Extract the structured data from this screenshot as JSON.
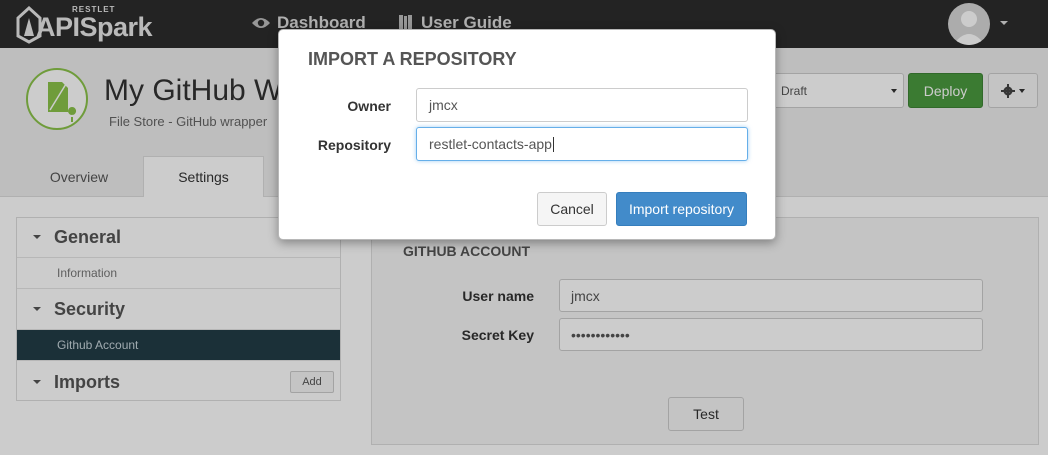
{
  "navbar": {
    "logo_small": "RESTLET",
    "logo_text": "APISpark",
    "links": [
      {
        "label": "Dashboard",
        "icon": "eye-icon"
      },
      {
        "label": "User Guide",
        "icon": "book-icon"
      }
    ]
  },
  "api": {
    "title": "My GitHub W",
    "subtitle": "File Store - GitHub wrapper",
    "status": "Draft",
    "deploy_label": "Deploy"
  },
  "tabs": [
    {
      "label": "Overview",
      "active": false
    },
    {
      "label": "Settings",
      "active": true
    }
  ],
  "sidebar": {
    "sections": [
      {
        "label": "General",
        "items": [
          "Information"
        ]
      },
      {
        "label": "Security",
        "items": [
          "Github Account"
        ]
      },
      {
        "label": "Imports",
        "items": [],
        "action": "Add"
      }
    ]
  },
  "panel": {
    "heading": "GITHUB ACCOUNT",
    "fields": [
      {
        "label": "User name",
        "value": "jmcx"
      },
      {
        "label": "Secret Key",
        "value": "••••••••••••"
      }
    ],
    "test_label": "Test"
  },
  "modal": {
    "title": "IMPORT A REPOSITORY",
    "fields": [
      {
        "label": "Owner",
        "value": "jmcx"
      },
      {
        "label": "Repository",
        "value": "restlet-contacts-app"
      }
    ],
    "cancel_label": "Cancel",
    "import_label": "Import repository"
  },
  "colors": {
    "navbar_bg": "#2c2c2c",
    "deploy_green": "#4a9a3f",
    "primary_blue": "#428bca",
    "active_item": "#223c47",
    "api_icon_green": "#8bc34a"
  }
}
